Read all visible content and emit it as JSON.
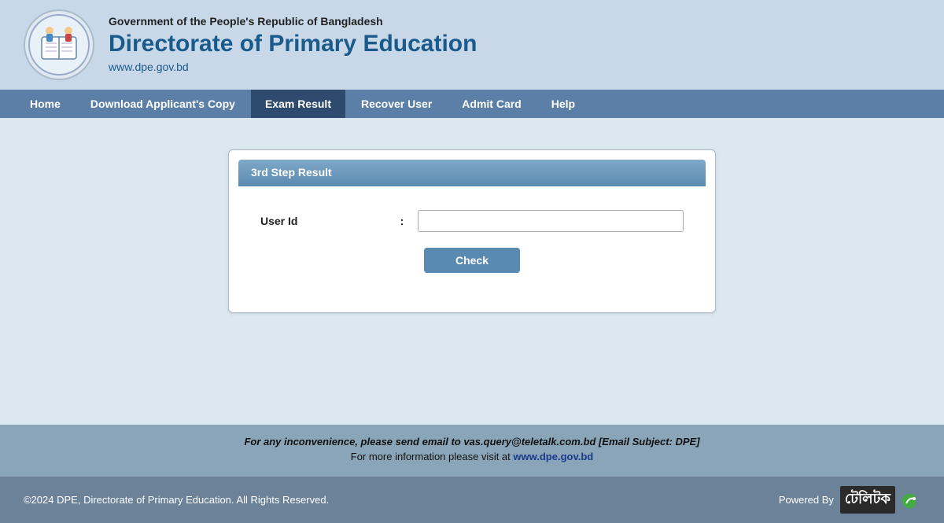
{
  "header": {
    "gov_name": "Government of the People's Republic of Bangladesh",
    "org_name": "Directorate of Primary Education",
    "website": "www.dpe.gov.bd"
  },
  "navbar": {
    "items": [
      {
        "label": "Home",
        "active": false
      },
      {
        "label": "Download Applicant's Copy",
        "active": false
      },
      {
        "label": "Exam Result",
        "active": true
      },
      {
        "label": "Recover User",
        "active": false
      },
      {
        "label": "Admit Card",
        "active": false
      },
      {
        "label": "Help",
        "active": false
      }
    ]
  },
  "form": {
    "card_title": "3rd Step Result",
    "user_id_label": "User Id",
    "colon": ":",
    "user_id_placeholder": "",
    "check_button_label": "Check"
  },
  "footer_info": {
    "line1": "For any inconvenience, please send email to vas.query@teletalk.com.bd [Email Subject: DPE]",
    "line2_text": "For more information please visit at ",
    "line2_link": "www.dpe.gov.bd"
  },
  "footer_bottom": {
    "copyright": "©2024 DPE, Directorate of Primary Education. All Rights Reserved.",
    "powered_by": "Powered By"
  }
}
